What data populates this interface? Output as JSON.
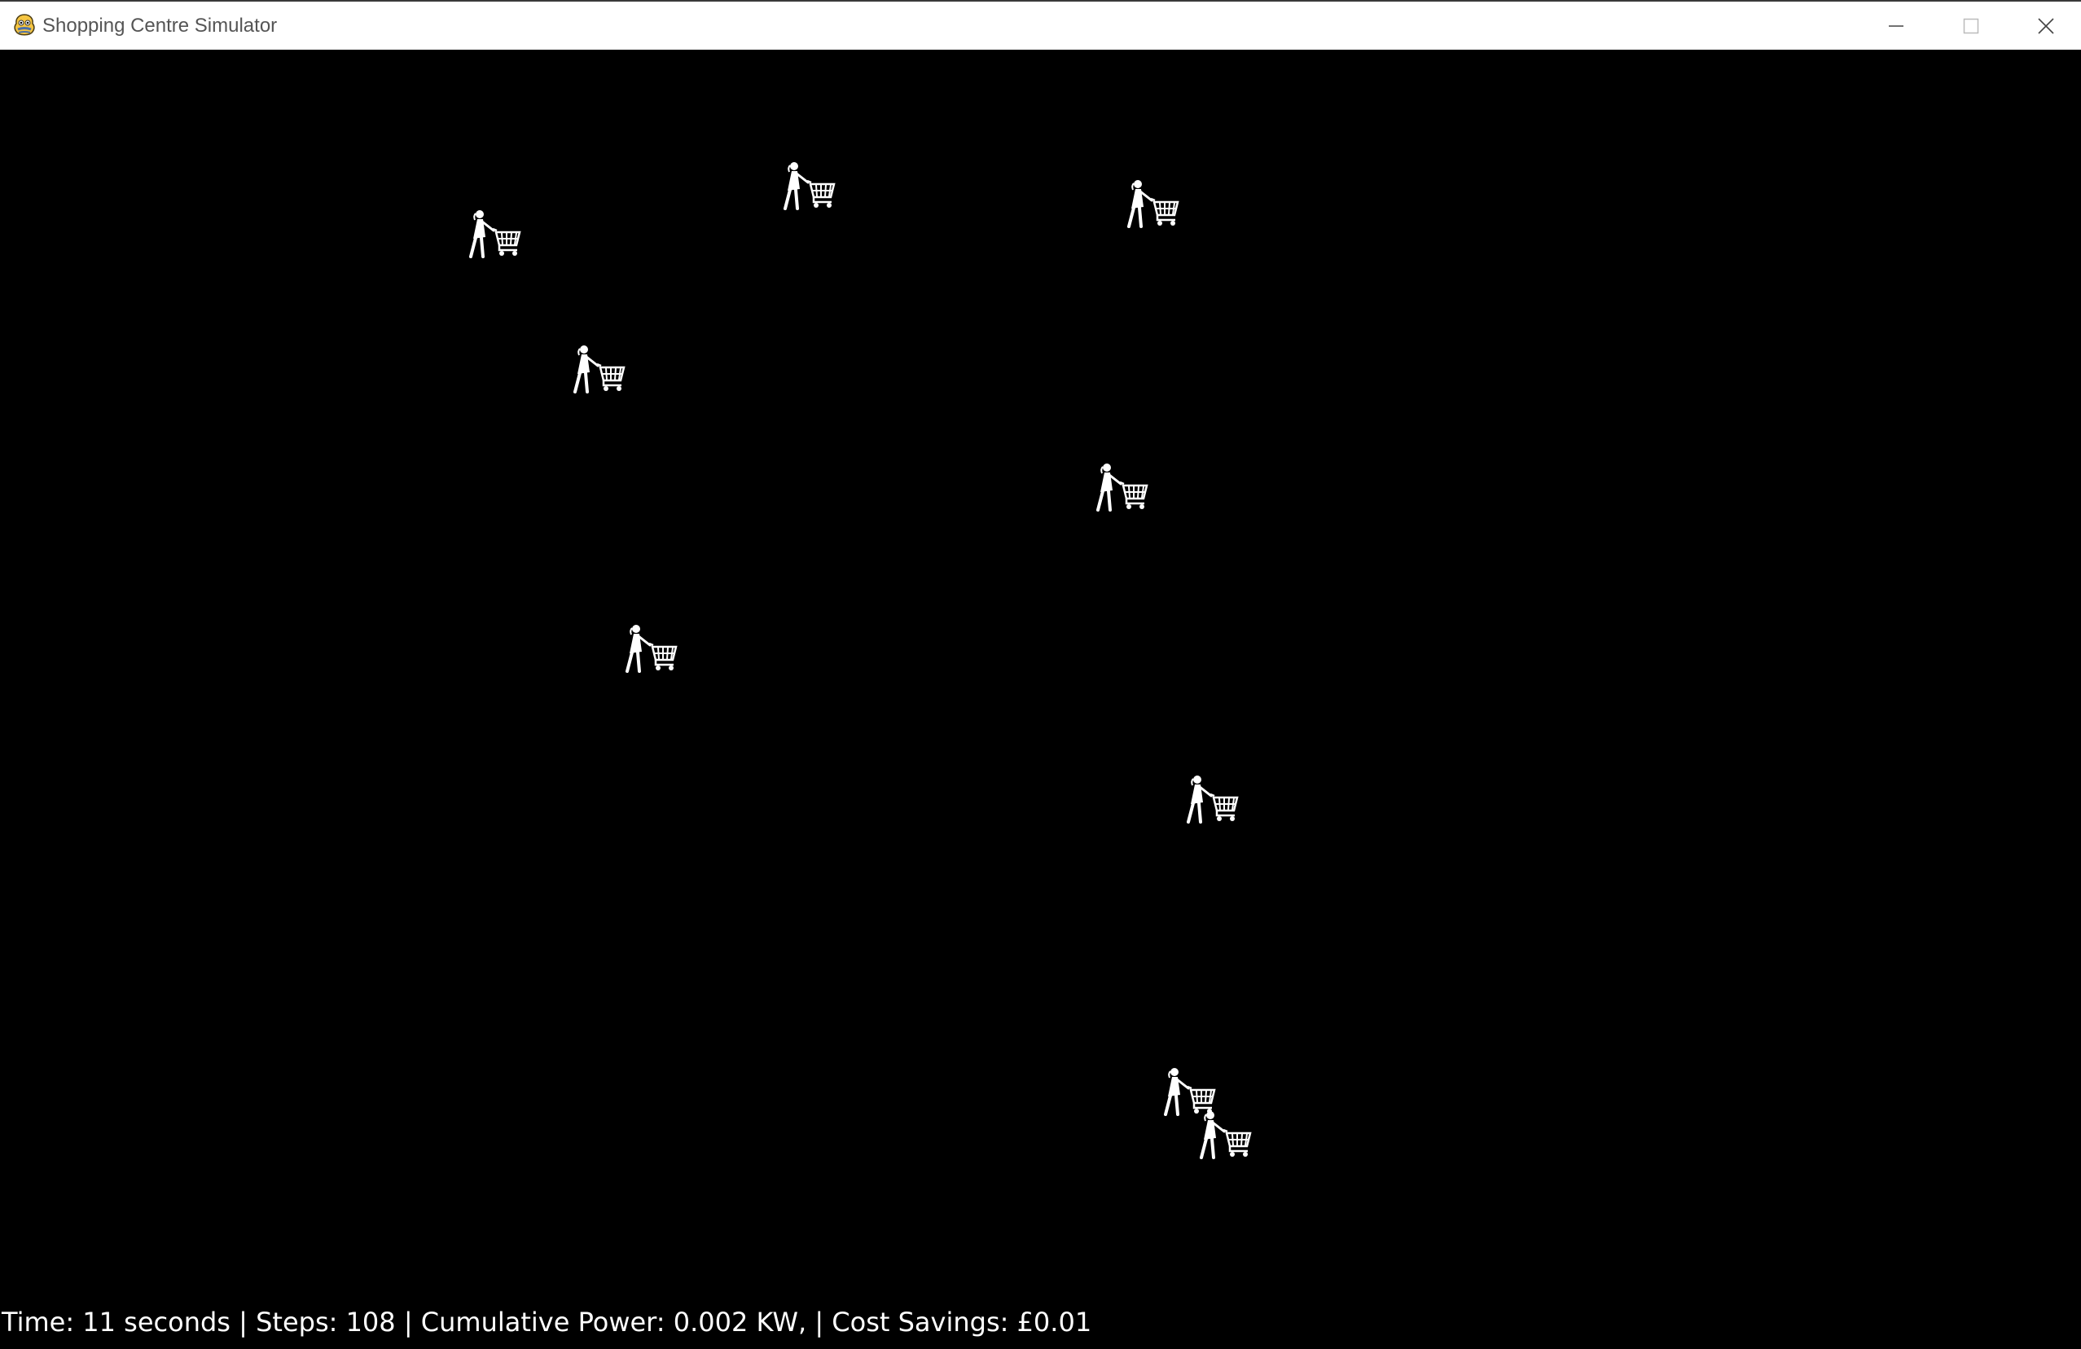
{
  "window": {
    "title": "Shopping Centre Simulator",
    "app_icon": "pygame-snake-icon",
    "controls": [
      "minimize-icon",
      "maximize-icon",
      "close-icon"
    ]
  },
  "simulation": {
    "background_color": "#000000",
    "shopper_color": "#ffffff",
    "shopper_icon": "shopper-with-cart-icon"
  },
  "status": {
    "time_label": "Time:",
    "time_value": "11",
    "time_unit": "seconds",
    "steps_label": "Steps:",
    "steps_value": "108",
    "power_label": "Cumulative Power:",
    "power_value": "0.002",
    "power_unit": "KW,",
    "savings_label": "Cost Savings:",
    "savings_value": "£0.01",
    "separator": "|"
  }
}
